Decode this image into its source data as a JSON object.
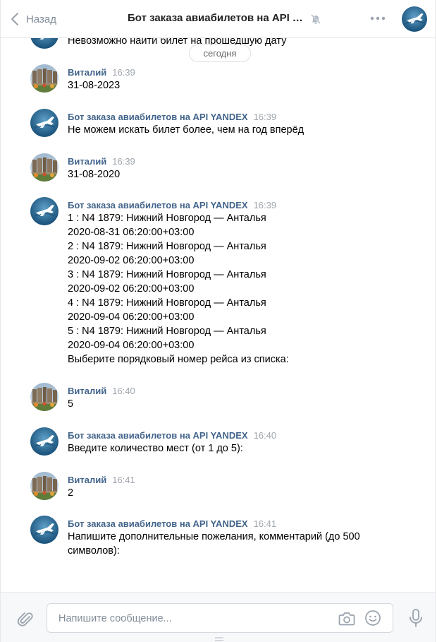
{
  "header": {
    "back_label": "Назад",
    "title": "Бот заказа авиабилетов на API YANDEX"
  },
  "date_separator": "сегодня",
  "prev_message": "Невозможно найти билет на прошедшую дату",
  "messages": [
    {
      "author": "Виталий",
      "time": "16:39",
      "lines": [
        "31-08-2023"
      ]
    },
    {
      "author": "Бот заказа авиабилетов на API YANDEX",
      "time": "16:39",
      "lines": [
        "Не можем искать билет более, чем на год вперёд"
      ]
    },
    {
      "author": "Виталий",
      "time": "16:39",
      "lines": [
        "31-08-2020"
      ]
    },
    {
      "author": "Бот заказа авиабилетов на API YANDEX",
      "time": "16:39",
      "lines": [
        "1 : N4 1879: Нижний Новгород — Анталья",
        "2020-08-31 06:20:00+03:00",
        "2 : N4 1879: Нижний Новгород — Анталья",
        "2020-09-02 06:20:00+03:00",
        "3 : N4 1879: Нижний Новгород — Анталья",
        "2020-09-02 06:20:00+03:00",
        "4 : N4 1879: Нижний Новгород — Анталья",
        "2020-09-04 06:20:00+03:00",
        "5 : N4 1879: Нижний Новгород — Анталья",
        "2020-09-04 06:20:00+03:00",
        "Выберите порядковый номер рейса из списка:"
      ]
    },
    {
      "author": "Виталий",
      "time": "16:40",
      "lines": [
        "5"
      ]
    },
    {
      "author": "Бот заказа авиабилетов на API YANDEX",
      "time": "16:40",
      "lines": [
        "Введите количество мест (от 1 до 5):"
      ]
    },
    {
      "author": "Виталий",
      "time": "16:41",
      "lines": [
        "2"
      ]
    },
    {
      "author": "Бот заказа авиабилетов на API YANDEX",
      "time": "16:41",
      "lines": [
        "Напишите дополнительные пожелания, комментарий (до 500",
        "символов):"
      ]
    }
  ],
  "composer": {
    "placeholder": "Напишите сообщение...",
    "value": ""
  },
  "icons": {
    "back": "chevron-left-icon",
    "mute": "muted-bell-icon",
    "more": "more-dots-icon",
    "attach": "paperclip-icon",
    "camera": "camera-icon",
    "emoji": "smile-icon",
    "mic": "microphone-icon"
  },
  "colors": {
    "author_name": "#42648b",
    "time": "#a0a6ad",
    "accent_bot_avatar": "#2f6f9a",
    "icon_gray": "#818c99"
  }
}
